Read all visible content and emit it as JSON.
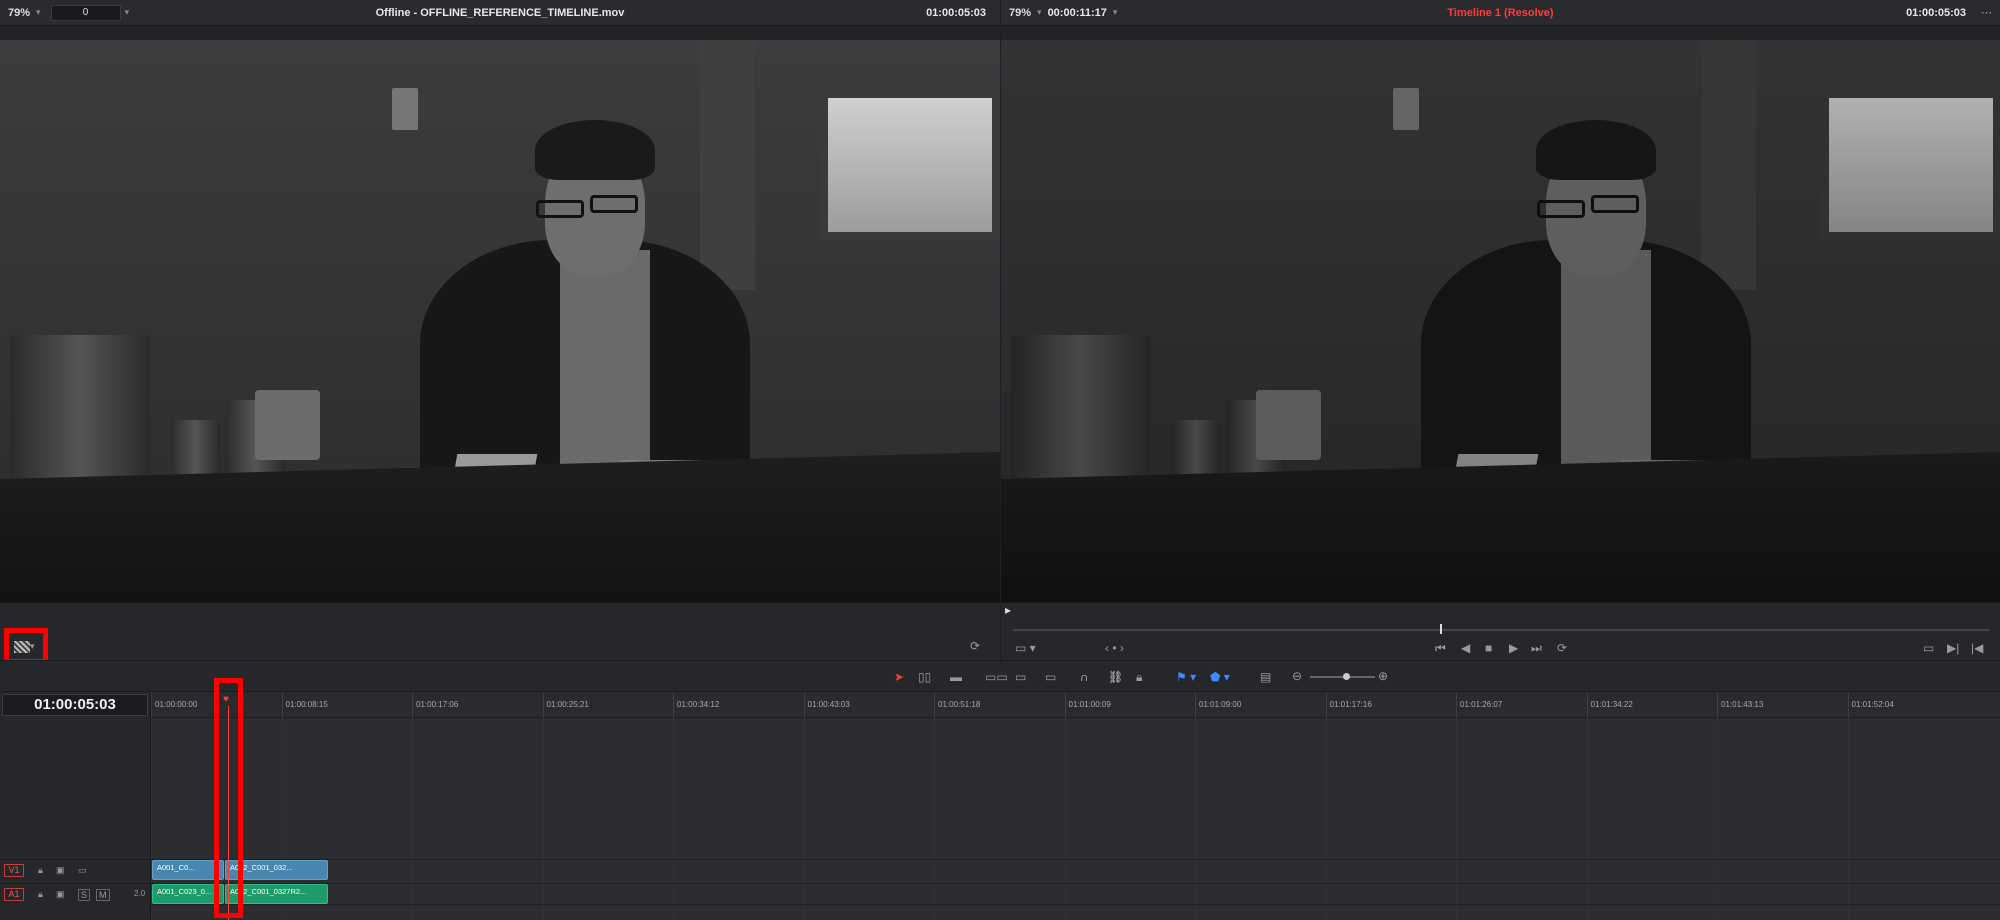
{
  "source_viewer": {
    "zoom": "79%",
    "field_value": "0",
    "title": "Offline - OFFLINE_REFERENCE_TIMELINE.mov",
    "timecode": "01:00:05:03"
  },
  "timeline_viewer": {
    "zoom": "79%",
    "timecode_left": "00:00:11:17",
    "title": "Timeline 1 (Resolve)",
    "timecode_right": "01:00:05:03"
  },
  "timeline": {
    "current_timecode": "01:00:05:03",
    "ruler_ticks": [
      "01:00:00:00",
      "01:00:08:15",
      "01:00:17:06",
      "01:00:25:21",
      "01:00:34:12",
      "01:00:43:03",
      "01:00:51:18",
      "01:01:00:09",
      "01:01:09:00",
      "01:01:17:16",
      "01:01:26:07",
      "01:01:34:22",
      "01:01:43:13",
      "01:01:52:04"
    ],
    "tracks": {
      "v1": {
        "label": "V1",
        "clips": [
          "A001_C0...",
          "A002_C001_032..."
        ]
      },
      "a1": {
        "label": "A1",
        "channels": "2.0",
        "s_label": "S",
        "m_label": "M",
        "clips": [
          "A001_C023_0...",
          "A002_C001_0327R2..."
        ]
      }
    }
  },
  "colors": {
    "accent_red": "#ff3b3b",
    "video_clip": "#4a87b0",
    "audio_clip": "#1f9a6b",
    "highlight_box": "#ff0000"
  }
}
